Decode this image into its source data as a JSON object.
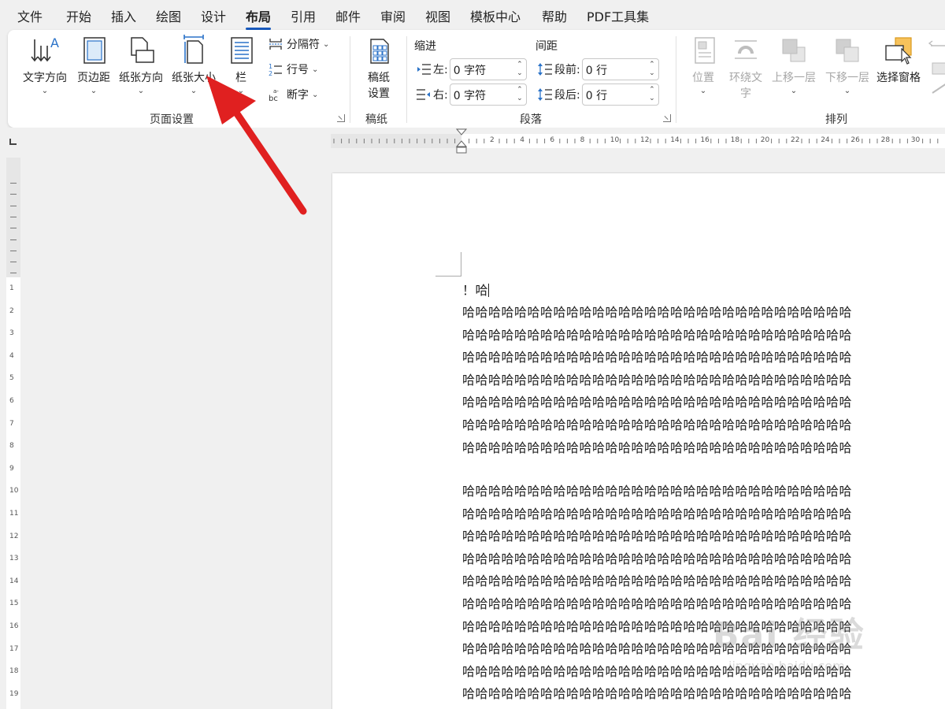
{
  "menu": {
    "items": [
      "文件",
      "开始",
      "插入",
      "绘图",
      "设计",
      "布局",
      "引用",
      "邮件",
      "审阅",
      "视图",
      "模板中心",
      "帮助",
      "PDF工具集"
    ],
    "active_index": 5
  },
  "ribbon": {
    "page_setup": {
      "text_direction": "文字方向",
      "margins": "页边距",
      "orientation": "纸张方向",
      "size": "纸张大小",
      "columns": "栏",
      "breaks": "分隔符",
      "line_numbers": "行号",
      "hyphenation": "断字",
      "group_label": "页面设置"
    },
    "manuscript": {
      "button_line1": "稿纸",
      "button_line2": "设置",
      "group_label": "稿纸"
    },
    "paragraph": {
      "indent_heading": "缩进",
      "spacing_heading": "间距",
      "left_label": "左:",
      "left_value": "0 字符",
      "right_label": "右:",
      "right_value": "0 字符",
      "before_label": "段前:",
      "before_value": "0 行",
      "after_label": "段后:",
      "after_value": "0 行",
      "group_label": "段落"
    },
    "arrange": {
      "position": "位置",
      "wrap_text_line1": "环绕文",
      "wrap_text_line2": "字",
      "bring_forward": "上移一层",
      "send_backward": "下移一层",
      "selection_pane": "选择窗格",
      "group_label": "排列"
    }
  },
  "ruler": {
    "h_labels": [
      "2",
      "4",
      "6",
      "8",
      "10",
      "12",
      "14",
      "16",
      "18",
      "20",
      "22",
      "24",
      "26",
      "28",
      "30"
    ],
    "v_labels": [
      "1",
      "2",
      "3",
      "4",
      "5",
      "6",
      "7",
      "8",
      "9",
      "10",
      "11",
      "12",
      "13",
      "14",
      "15",
      "16",
      "17",
      "18",
      "19"
    ]
  },
  "document": {
    "first_line": "！哈",
    "block1": [
      "哈哈哈哈哈哈哈哈哈哈哈哈哈哈哈哈哈哈哈哈哈哈哈哈哈哈哈哈哈哈",
      "哈哈哈哈哈哈哈哈哈哈哈哈哈哈哈哈哈哈哈哈哈哈哈哈哈哈哈哈哈哈",
      "哈哈哈哈哈哈哈哈哈哈哈哈哈哈哈哈哈哈哈哈哈哈哈哈哈哈哈哈哈哈",
      "哈哈哈哈哈哈哈哈哈哈哈哈哈哈哈哈哈哈哈哈哈哈哈哈哈哈哈哈哈哈",
      "哈哈哈哈哈哈哈哈哈哈哈哈哈哈哈哈哈哈哈哈哈哈哈哈哈哈哈哈哈哈",
      "哈哈哈哈哈哈哈哈哈哈哈哈哈哈哈哈哈哈哈哈哈哈哈哈哈哈哈哈哈哈",
      "哈哈哈哈哈哈哈哈哈哈哈哈哈哈哈哈哈哈哈哈哈哈哈哈哈哈哈哈哈哈"
    ],
    "block2": [
      "哈哈哈哈哈哈哈哈哈哈哈哈哈哈哈哈哈哈哈哈哈哈哈哈哈哈哈哈哈哈",
      "哈哈哈哈哈哈哈哈哈哈哈哈哈哈哈哈哈哈哈哈哈哈哈哈哈哈哈哈哈哈",
      "哈哈哈哈哈哈哈哈哈哈哈哈哈哈哈哈哈哈哈哈哈哈哈哈哈哈哈哈哈哈",
      "哈哈哈哈哈哈哈哈哈哈哈哈哈哈哈哈哈哈哈哈哈哈哈哈哈哈哈哈哈哈",
      "哈哈哈哈哈哈哈哈哈哈哈哈哈哈哈哈哈哈哈哈哈哈哈哈哈哈哈哈哈哈",
      "哈哈哈哈哈哈哈哈哈哈哈哈哈哈哈哈哈哈哈哈哈哈哈哈哈哈哈哈哈哈",
      "哈哈哈哈哈哈哈哈哈哈哈哈哈哈哈哈哈哈哈哈哈哈哈哈哈哈哈哈哈哈",
      "哈哈哈哈哈哈哈哈哈哈哈哈哈哈哈哈哈哈哈哈哈哈哈哈哈哈哈哈哈哈",
      "哈哈哈哈哈哈哈哈哈哈哈哈哈哈哈哈哈哈哈哈哈哈哈哈哈哈哈哈哈哈",
      "哈哈哈哈哈哈哈哈哈哈哈哈哈哈哈哈哈哈哈哈哈哈哈哈哈哈哈哈哈哈"
    ]
  },
  "watermark": {
    "brand": "Bai 经验",
    "url": "jingyan.baidu.com"
  },
  "colors": {
    "accent": "#185abd",
    "arrow": "#e02020"
  }
}
